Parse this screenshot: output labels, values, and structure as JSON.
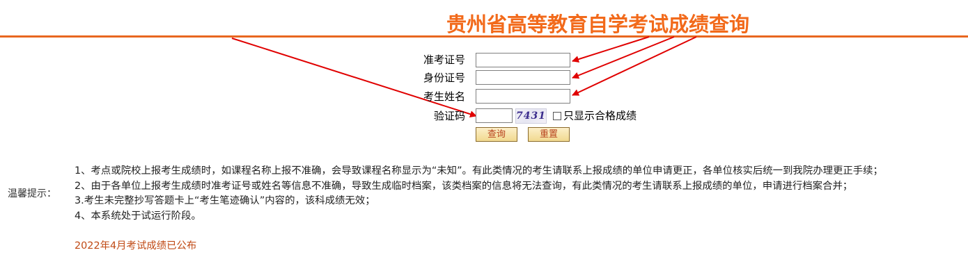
{
  "header": {
    "title": "贵州省高等教育自学考试成绩查询"
  },
  "form": {
    "exam_no_label": "准考证号",
    "id_no_label": "身份证号",
    "name_label": "考生姓名",
    "captcha_label": "验证码",
    "captcha_text": "7431",
    "passed_only_label": "只显示合格成绩",
    "query_button": "查询",
    "reset_button": "重置"
  },
  "tips": {
    "label": "温馨提示：",
    "items": [
      "1、考点或院校上报考生成绩时，如课程名称上报不准确，会导致课程名称显示为“未知”。有此类情况的考生请联系上报成绩的单位申请更正，各单位核实后统一到我院办理更正手续；",
      "2、由于各单位上报考生成绩时准考证号或姓名等信息不准确，导致生成临时档案，该类档案的信息将无法查询，有此类情况的考生请联系上报成绩的单位，申请进行档案合并；",
      "3.考生未完整抄写答题卡上“考生笔迹确认”内容的，该科成绩无效；",
      "4、本系统处于试运行阶段。"
    ]
  },
  "notice": "2022年4月考试成绩已公布",
  "colors": {
    "title": "#f26a1b",
    "rule": "#e8661f",
    "arrow": "#e00000",
    "notice": "#c04a15"
  }
}
